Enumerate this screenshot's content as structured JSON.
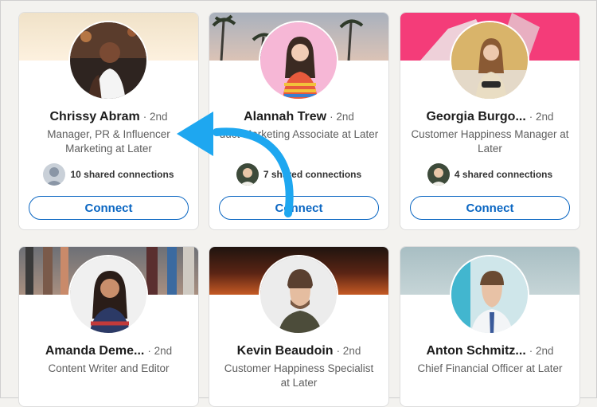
{
  "cards": [
    {
      "name": "Chrissy Abram",
      "degree": "· 2nd",
      "headline": "Manager, PR & Influencer Marketing at Later",
      "shared": "10 shared connections",
      "connect": "Connect",
      "colors": {
        "banner_top": "#f1e3cc",
        "banner_bottom": "#fbeedd"
      }
    },
    {
      "name": "Alannah Trew",
      "degree": "· 2nd",
      "headline": "duct Marketing Associate at Later",
      "shared": "7 shared connections",
      "connect": "Connect",
      "colors": {
        "banner_top": "#b8bec9",
        "banner_bottom": "#d8c1b6"
      }
    },
    {
      "name": "Georgia Burgo...",
      "degree": "· 2nd",
      "headline": "Customer Happiness Manager at Later",
      "shared": "4 shared connections",
      "connect": "Connect",
      "colors": {
        "banner_top": "#f53e7b",
        "banner_bottom": "#ef2f6f"
      }
    },
    {
      "name": "Amanda Deme...",
      "degree": "· 2nd",
      "headline": "Content Writer and Editor",
      "colors": {
        "banner_top": "#6a6e74",
        "banner_bottom": "#ad8f7b"
      }
    },
    {
      "name": "Kevin Beaudoin",
      "degree": "· 2nd",
      "headline": "Customer Happiness Specialist at Later",
      "colors": {
        "banner_top": "#2c1b14",
        "banner_bottom": "#b64a1d"
      }
    },
    {
      "name": "Anton Schmitz...",
      "degree": "· 2nd",
      "headline": "Chief Financial Officer at Later",
      "colors": {
        "banner_top": "#a9c0c4",
        "banner_bottom": "#c7d6d8"
      }
    }
  ],
  "annotation": {
    "arrow_color": "#1ea7f0"
  }
}
